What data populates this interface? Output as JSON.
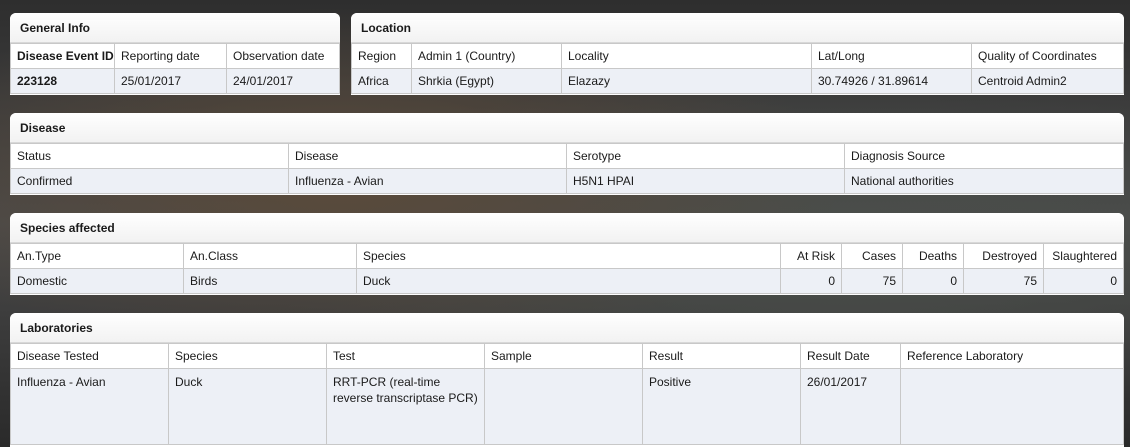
{
  "general_info": {
    "title": "General Info",
    "headers": [
      "Disease Event ID",
      "Reporting date",
      "Observation date"
    ],
    "row": [
      "223128",
      "25/01/2017",
      "24/01/2017"
    ]
  },
  "location": {
    "title": "Location",
    "headers": [
      "Region",
      "Admin 1 (Country)",
      "Locality",
      "Lat/Long",
      "Quality of Coordinates"
    ],
    "row": [
      "Africa",
      "Shrkia (Egypt)",
      "Elazazy",
      "30.74926 / 31.89614",
      "Centroid Admin2"
    ]
  },
  "disease": {
    "title": "Disease",
    "headers": [
      "Status",
      "Disease",
      "Serotype",
      "Diagnosis Source"
    ],
    "row": [
      "Confirmed",
      "Influenza - Avian",
      "H5N1 HPAI",
      "National authorities"
    ]
  },
  "species": {
    "title": "Species affected",
    "headers": [
      "An.Type",
      "An.Class",
      "Species",
      "At Risk",
      "Cases",
      "Deaths",
      "Destroyed",
      "Slaughtered"
    ],
    "row": [
      "Domestic",
      "Birds",
      "Duck",
      "0",
      "75",
      "0",
      "75",
      "0"
    ]
  },
  "laboratories": {
    "title": "Laboratories",
    "headers": [
      "Disease Tested",
      "Species",
      "Test",
      "Sample",
      "Result",
      "Result Date",
      "Reference Laboratory"
    ],
    "row": [
      "Influenza - Avian",
      "Duck",
      "RRT-PCR (real-time reverse transcriptase PCR)",
      "",
      "Positive",
      "26/01/2017",
      ""
    ]
  }
}
